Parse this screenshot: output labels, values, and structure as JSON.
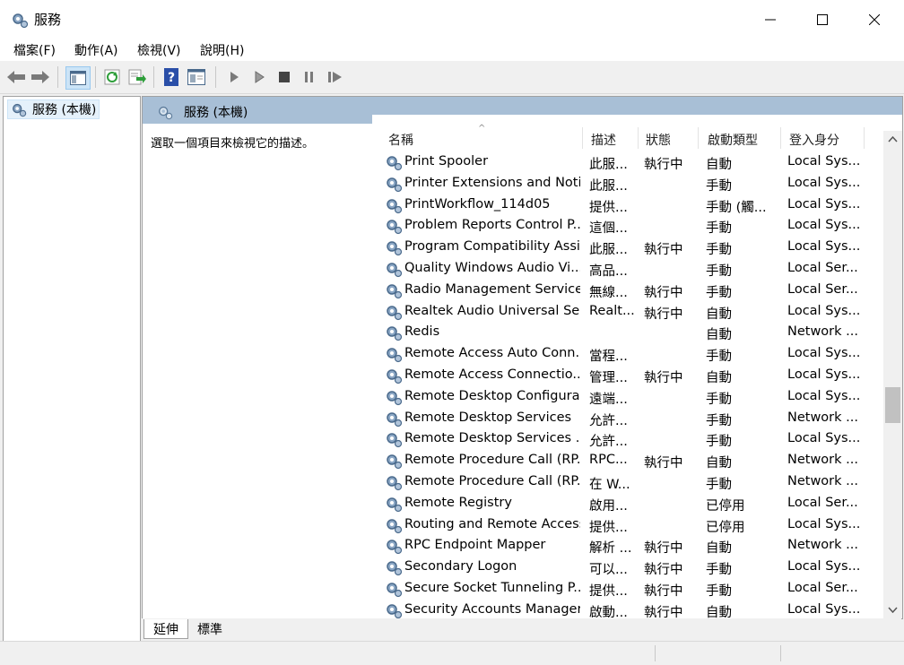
{
  "window": {
    "title": "服務"
  },
  "menu": [
    "檔案(F)",
    "動作(A)",
    "檢視(V)",
    "說明(H)"
  ],
  "tree": {
    "root_label": "服務 (本機)"
  },
  "pane": {
    "header": "服務 (本機)",
    "description_prompt": "選取一個項目來檢視它的描述。"
  },
  "columns": {
    "name": "名稱",
    "desc": "描述",
    "status": "狀態",
    "startup": "啟動類型",
    "logon": "登入身分"
  },
  "services": [
    {
      "name": "Print Spooler",
      "desc": "此服...",
      "status": "執行中",
      "startup": "自動",
      "logon": "Local Sys..."
    },
    {
      "name": "Printer Extensions and Noti...",
      "desc": "此服...",
      "status": "",
      "startup": "手動",
      "logon": "Local Sys..."
    },
    {
      "name": "PrintWorkflow_114d05",
      "desc": "提供...",
      "status": "",
      "startup": "手動 (觸...",
      "logon": "Local Sys..."
    },
    {
      "name": "Problem Reports Control P...",
      "desc": "這個...",
      "status": "",
      "startup": "手動",
      "logon": "Local Sys..."
    },
    {
      "name": "Program Compatibility Assi...",
      "desc": "此服...",
      "status": "執行中",
      "startup": "手動",
      "logon": "Local Sys..."
    },
    {
      "name": "Quality Windows Audio Vi...",
      "desc": "高品...",
      "status": "",
      "startup": "手動",
      "logon": "Local Ser..."
    },
    {
      "name": "Radio Management Service",
      "desc": "無線...",
      "status": "執行中",
      "startup": "手動",
      "logon": "Local Ser..."
    },
    {
      "name": "Realtek Audio Universal Se...",
      "desc": "Realt...",
      "status": "執行中",
      "startup": "自動",
      "logon": "Local Sys..."
    },
    {
      "name": "Redis",
      "desc": "",
      "status": "",
      "startup": "自動",
      "logon": "Network ..."
    },
    {
      "name": "Remote Access Auto Conn...",
      "desc": "當程...",
      "status": "",
      "startup": "手動",
      "logon": "Local Sys..."
    },
    {
      "name": "Remote Access Connectio...",
      "desc": "管理...",
      "status": "執行中",
      "startup": "自動",
      "logon": "Local Sys..."
    },
    {
      "name": "Remote Desktop Configura...",
      "desc": "遠端...",
      "status": "",
      "startup": "手動",
      "logon": "Local Sys..."
    },
    {
      "name": "Remote Desktop Services",
      "desc": "允許...",
      "status": "",
      "startup": "手動",
      "logon": "Network ..."
    },
    {
      "name": "Remote Desktop Services ...",
      "desc": "允許...",
      "status": "",
      "startup": "手動",
      "logon": "Local Sys..."
    },
    {
      "name": "Remote Procedure Call (RP...",
      "desc": "RPC...",
      "status": "執行中",
      "startup": "自動",
      "logon": "Network ..."
    },
    {
      "name": "Remote Procedure Call (RP...",
      "desc": "在 W...",
      "status": "",
      "startup": "手動",
      "logon": "Network ..."
    },
    {
      "name": "Remote Registry",
      "desc": "啟用...",
      "status": "",
      "startup": "已停用",
      "logon": "Local Ser..."
    },
    {
      "name": "Routing and Remote Access",
      "desc": "提供...",
      "status": "",
      "startup": "已停用",
      "logon": "Local Sys..."
    },
    {
      "name": "RPC Endpoint Mapper",
      "desc": "解析 ...",
      "status": "執行中",
      "startup": "自動",
      "logon": "Network ..."
    },
    {
      "name": "Secondary Logon",
      "desc": "可以...",
      "status": "執行中",
      "startup": "手動",
      "logon": "Local Sys..."
    },
    {
      "name": "Secure Socket Tunneling P...",
      "desc": "提供...",
      "status": "執行中",
      "startup": "手動",
      "logon": "Local Ser..."
    },
    {
      "name": "Security Accounts Manager",
      "desc": "啟動...",
      "status": "執行中",
      "startup": "自動",
      "logon": "Local Sys..."
    }
  ],
  "tabs": [
    "延伸",
    "標準"
  ]
}
